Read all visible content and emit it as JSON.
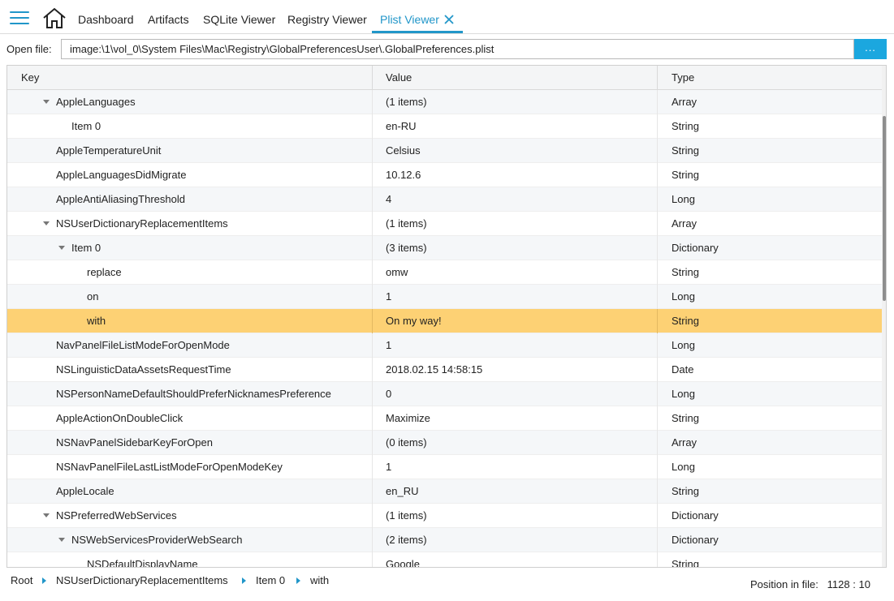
{
  "nav": {
    "tabs": [
      {
        "label": "Dashboard"
      },
      {
        "label": "Artifacts"
      },
      {
        "label": "SQLite Viewer"
      },
      {
        "label": "Registry Viewer"
      },
      {
        "label": "Plist Viewer"
      }
    ],
    "active_tab": "Plist Viewer",
    "accent_color": "#2196c9"
  },
  "open_file": {
    "label": "Open file:",
    "value": "image:\\1\\vol_0\\System Files\\Mac\\Registry\\GlobalPreferencesUser\\.GlobalPreferences.plist",
    "browse_label": "..."
  },
  "table": {
    "columns": [
      "Key",
      "Value",
      "Type"
    ],
    "rows": [
      {
        "key": "AppleLanguages",
        "value": "(1 items)",
        "type": "Array",
        "level": 1,
        "expanded": true
      },
      {
        "key": "Item 0",
        "value": "en-RU",
        "type": "String",
        "level": 2
      },
      {
        "key": "AppleTemperatureUnit",
        "value": "Celsius",
        "type": "String",
        "level": 1
      },
      {
        "key": "AppleLanguagesDidMigrate",
        "value": "10.12.6",
        "type": "String",
        "level": 1
      },
      {
        "key": "AppleAntiAliasingThreshold",
        "value": "4",
        "type": "Long",
        "level": 1
      },
      {
        "key": "NSUserDictionaryReplacementItems",
        "value": "(1 items)",
        "type": "Array",
        "level": 1,
        "expanded": true
      },
      {
        "key": "Item 0",
        "value": "(3 items)",
        "type": "Dictionary",
        "level": 2,
        "expanded": true
      },
      {
        "key": "replace",
        "value": "omw",
        "type": "String",
        "level": 3
      },
      {
        "key": "on",
        "value": "1",
        "type": "Long",
        "level": 3
      },
      {
        "key": "with",
        "value": "On my way!",
        "type": "String",
        "level": 3,
        "selected": true
      },
      {
        "key": "NavPanelFileListModeForOpenMode",
        "value": "1",
        "type": "Long",
        "level": 1
      },
      {
        "key": "NSLinguisticDataAssetsRequestTime",
        "value": "2018.02.15 14:58:15",
        "type": "Date",
        "level": 1
      },
      {
        "key": "NSPersonNameDefaultShouldPreferNicknamesPreference",
        "value": "0",
        "type": "Long",
        "level": 1
      },
      {
        "key": "AppleActionOnDoubleClick",
        "value": "Maximize",
        "type": "String",
        "level": 1
      },
      {
        "key": "NSNavPanelSidebarKeyForOpen",
        "value": "(0 items)",
        "type": "Array",
        "level": 1
      },
      {
        "key": "NSNavPanelFileLastListModeForOpenModeKey",
        "value": "1",
        "type": "Long",
        "level": 1
      },
      {
        "key": "AppleLocale",
        "value": "en_RU",
        "type": "String",
        "level": 1
      },
      {
        "key": "NSPreferredWebServices",
        "value": "(1 items)",
        "type": "Dictionary",
        "level": 1,
        "expanded": true
      },
      {
        "key": "NSWebServicesProviderWebSearch",
        "value": "(2 items)",
        "type": "Dictionary",
        "level": 2,
        "expanded": true
      },
      {
        "key": "NSDefaultDisplayName",
        "value": "Google",
        "type": "String",
        "level": 3
      }
    ],
    "selected_color": "#fdd174"
  },
  "status": {
    "breadcrumb": [
      "Root",
      "NSUserDictionaryReplacementItems",
      "Item 0",
      "with"
    ],
    "position_label": "Position in file:",
    "position_value": "1128 : 10"
  }
}
